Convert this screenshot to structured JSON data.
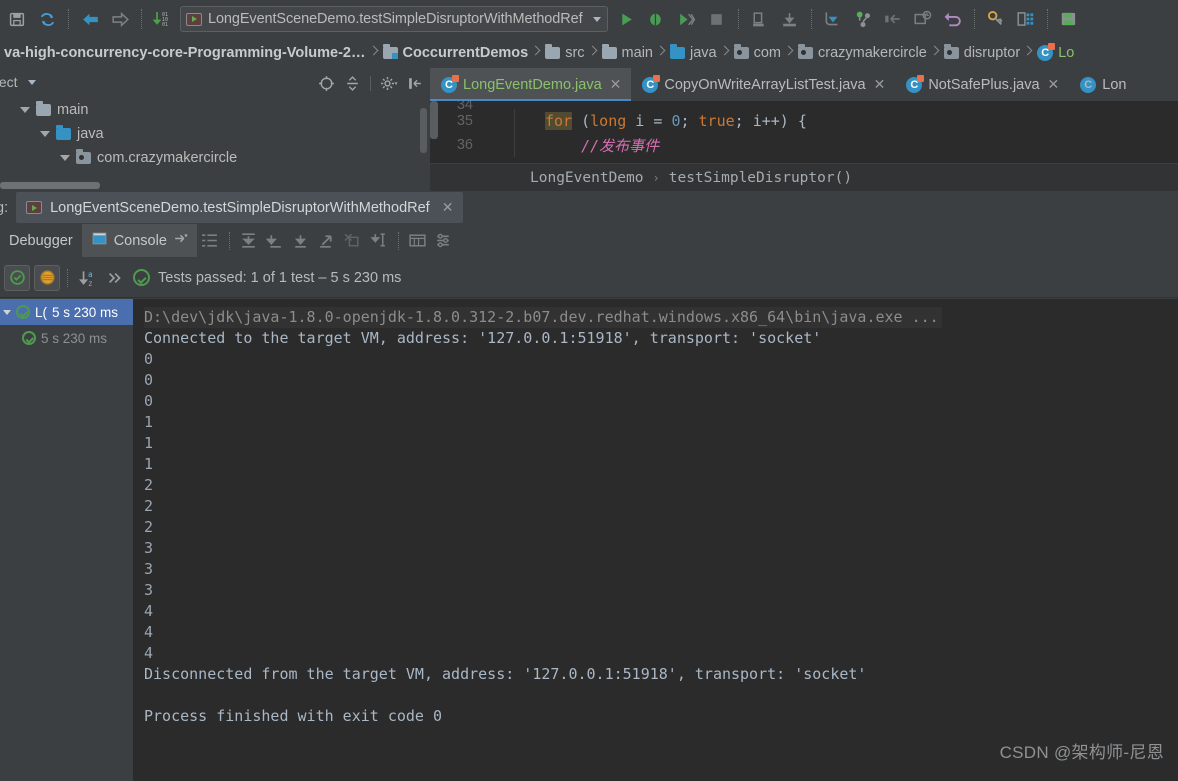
{
  "toolbar": {
    "icons": [
      {
        "name": "save-all-icon"
      },
      {
        "name": "sync-refresh-icon"
      },
      {
        "name": "back-arrow-icon"
      },
      {
        "name": "forward-arrow-icon"
      },
      {
        "name": "compile-icon"
      }
    ],
    "run_configuration": {
      "label": "LongEventSceneDemo.testSimpleDisruptorWithMethodRef",
      "icon": "run-config-icon",
      "dropdown_icon": "chevron-down-icon"
    },
    "right_icons": [
      {
        "name": "run-icon"
      },
      {
        "name": "debug-icon"
      },
      {
        "name": "run-coverage-icon"
      },
      {
        "name": "stop-icon"
      },
      {
        "name": "step-over-icon"
      },
      {
        "name": "step-into-icon"
      },
      {
        "name": "resume-program-icon"
      },
      {
        "name": "git-branch-icon"
      },
      {
        "name": "step-out-icon"
      },
      {
        "name": "evaluate-expression-icon"
      },
      {
        "name": "undo-icon"
      },
      {
        "name": "settings-wrench-icon"
      },
      {
        "name": "database-icon"
      },
      {
        "name": "save-disk-icon"
      }
    ]
  },
  "breadcrumbs": {
    "items": [
      {
        "label": "va-high-concurrency-core-Programming-Volume-2…",
        "icon": "none",
        "bold": true
      },
      {
        "label": "CoccurrentDemos",
        "icon": "module-folder-icon",
        "bold": true
      },
      {
        "label": "src",
        "icon": "source-folder-icon",
        "bold": false
      },
      {
        "label": "main",
        "icon": "folder-icon",
        "bold": false
      },
      {
        "label": "java",
        "icon": "java-source-folder-icon",
        "bold": false
      },
      {
        "label": "com",
        "icon": "package-icon",
        "bold": false
      },
      {
        "label": "crazymakercircle",
        "icon": "package-icon",
        "bold": false
      },
      {
        "label": "disruptor",
        "icon": "package-icon",
        "bold": false
      },
      {
        "label": "Lo",
        "icon": "java-class-icon",
        "bold": false
      }
    ]
  },
  "project_panel": {
    "title": "oject",
    "dropdown_icon": "chevron-down-icon",
    "tools": [
      {
        "name": "locate-target-icon"
      },
      {
        "name": "collapse-all-icon"
      },
      {
        "name": "settings-gear-icon"
      },
      {
        "name": "hide-panel-icon"
      }
    ],
    "tree": [
      {
        "label": "main",
        "icon": "folder-icon",
        "indent": 0,
        "expanded": true
      },
      {
        "label": "java",
        "icon": "java-source-folder-icon",
        "indent": 1,
        "expanded": true
      },
      {
        "label": "com.crazymakercircle",
        "icon": "package-icon",
        "indent": 2,
        "expanded": true
      }
    ]
  },
  "editor": {
    "tabs": [
      {
        "label": "LongEventDemo.java",
        "icon": "java-class-icon",
        "active": true,
        "closable": true
      },
      {
        "label": "CopyOnWriteArrayListTest.java",
        "icon": "java-class-icon",
        "active": false,
        "closable": true
      },
      {
        "label": "NotSafePlus.java",
        "icon": "java-class-icon",
        "active": false,
        "closable": true
      },
      {
        "label": "Lon",
        "icon": "java-interface-icon",
        "active": false,
        "closable": false
      }
    ],
    "lines": [
      {
        "number": "35",
        "tokens": [
          {
            "text": "for",
            "style": "kw-for"
          },
          {
            "text": " (",
            "style": "plain"
          },
          {
            "text": "long",
            "style": "kw"
          },
          {
            "text": " i = ",
            "style": "plain"
          },
          {
            "text": "0",
            "style": "num"
          },
          {
            "text": "; ",
            "style": "plain"
          },
          {
            "text": "true",
            "style": "kw"
          },
          {
            "text": "; i++) {",
            "style": "plain"
          }
        ]
      },
      {
        "number": "36",
        "tokens": [
          {
            "text": "    //发布事件",
            "style": "cmt"
          }
        ]
      }
    ],
    "breadcrumb": [
      "LongEventDemo",
      "testSimpleDisruptor()"
    ]
  },
  "debug_window": {
    "prefix_label": "g:",
    "tab": {
      "label": "LongEventSceneDemo.testSimpleDisruptorWithMethodRef",
      "icon": "run-config-icon",
      "close_icon": "close-icon"
    }
  },
  "console_toolbar": {
    "tabs": [
      {
        "label": "Debugger",
        "active": false,
        "icon": "none"
      },
      {
        "label": "Console",
        "active": true,
        "icon": "console-icon"
      }
    ],
    "pin_icon": "pin-tab-icon",
    "icons": [
      {
        "name": "soft-wrap-icon"
      },
      {
        "name": "scroll-to-end-icon"
      },
      {
        "name": "step-over-icon"
      },
      {
        "name": "step-into-icon"
      },
      {
        "name": "step-out-icon"
      },
      {
        "name": "mute-breakpoints-icon"
      },
      {
        "name": "run-to-cursor-icon"
      },
      {
        "name": "print-icon"
      },
      {
        "name": "settings-list-icon"
      }
    ]
  },
  "test_bar": {
    "toggles": [
      {
        "name": "show-passed-toggle",
        "icon": "check-circle-icon",
        "active": true
      },
      {
        "name": "show-ignored-toggle",
        "icon": "striped-circle-icon",
        "active": true
      }
    ],
    "sort_icon": "sort-alphabetically-icon",
    "expand_icon": "expand-chevrons-icon",
    "status_icon": "check-circle-icon",
    "status_text": "Tests passed: 1 of 1 test – 5 s 230 ms"
  },
  "test_tree": {
    "rows": [
      {
        "label": "L(",
        "time": "5 s 230 ms",
        "selected": true,
        "has_arrow": true,
        "icon": "check-circle-icon"
      },
      {
        "label": "",
        "time": "5 s 230 ms",
        "selected": false,
        "has_arrow": false,
        "icon": "check-circle-icon"
      }
    ]
  },
  "console": {
    "lines": [
      {
        "text": "D:\\dev\\jdk\\java-1.8.0-openjdk-1.8.0.312-2.b07.dev.redhat.windows.x86_64\\bin\\java.exe ...",
        "style": "cmdline"
      },
      {
        "text": "Connected to the target VM, address: '127.0.0.1:51918', transport: 'socket'",
        "style": "out"
      },
      {
        "text": "0",
        "style": "num"
      },
      {
        "text": "0",
        "style": "num"
      },
      {
        "text": "0",
        "style": "num"
      },
      {
        "text": "1",
        "style": "num"
      },
      {
        "text": "1",
        "style": "num"
      },
      {
        "text": "1",
        "style": "num"
      },
      {
        "text": "2",
        "style": "num"
      },
      {
        "text": "2",
        "style": "num"
      },
      {
        "text": "2",
        "style": "num"
      },
      {
        "text": "3",
        "style": "num"
      },
      {
        "text": "3",
        "style": "num"
      },
      {
        "text": "3",
        "style": "num"
      },
      {
        "text": "4",
        "style": "num"
      },
      {
        "text": "4",
        "style": "num"
      },
      {
        "text": "4",
        "style": "num"
      },
      {
        "text": "Disconnected from the target VM, address: '127.0.0.1:51918', transport: 'socket'",
        "style": "out"
      },
      {
        "text": "",
        "style": "out"
      },
      {
        "text": "Process finished with exit code 0",
        "style": "out"
      }
    ]
  },
  "watermark": "CSDN @架构师-尼恩",
  "colors": {
    "background": "#3c3f41",
    "editor_background": "#2b2b2b",
    "accent_blue": "#4b6eaf",
    "tab_underline": "#4a88c7",
    "pass_green": "#4e9a4e",
    "active_tab_text": "#8ac16a",
    "keyword_orange": "#cc7832",
    "number_blue": "#6897bb",
    "comment_pink": "#d96eb4"
  }
}
